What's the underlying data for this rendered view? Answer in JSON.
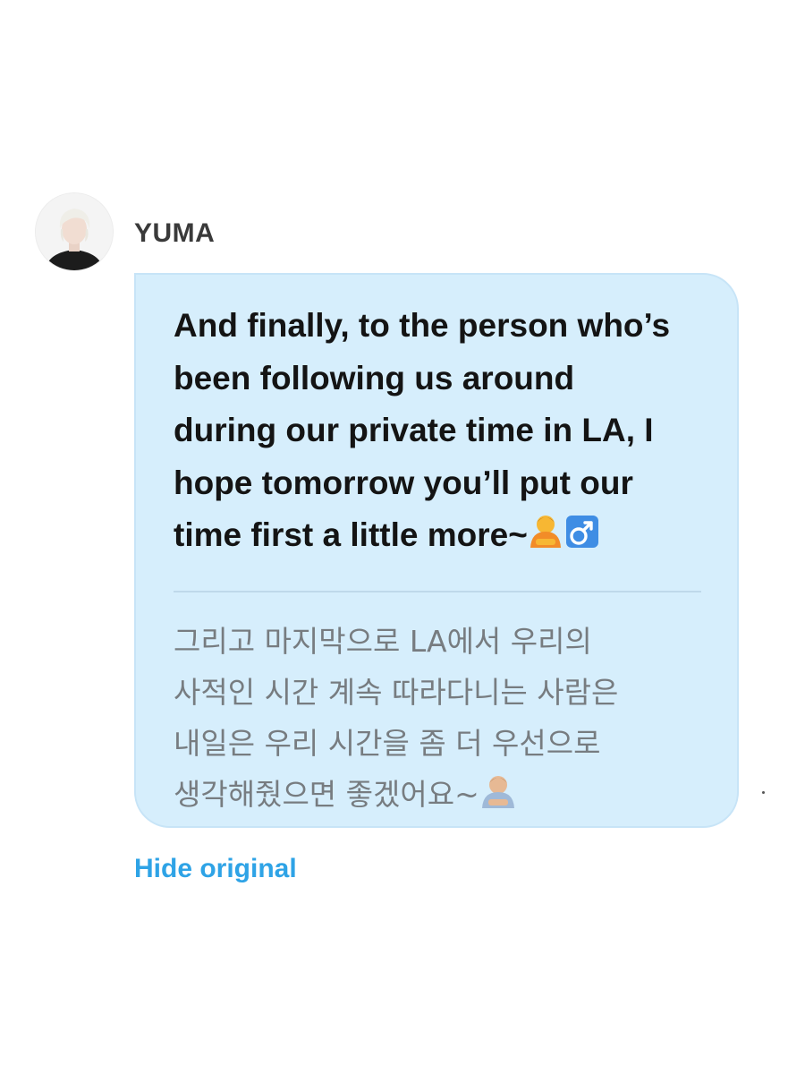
{
  "message": {
    "sender": {
      "name": "YUMA",
      "avatar_icon": "profile-photo-avatar"
    },
    "translated_text": "And finally, to the person who’s\nbeen following us around\nduring our private time in LA, I\nhope tomorrow you’ll put our\ntime first a little more~",
    "translated_emoji_icon": "person-bowing-male-emoji",
    "original_text": "그리고 마지막으로 LA에서 우리의\n사적인 시간 계속 따라다니는 사람은\n내일은 우리 시간을 좀 더 우선으로\n생각해줬으면 좋겠어요~",
    "original_emoji_icon": "person-bowing-emoji",
    "hide_original_label": "Hide original"
  },
  "colors": {
    "bubble_bg": "#d6eefc",
    "link_blue": "#2ea3e6",
    "original_text_gray": "#777c80"
  }
}
